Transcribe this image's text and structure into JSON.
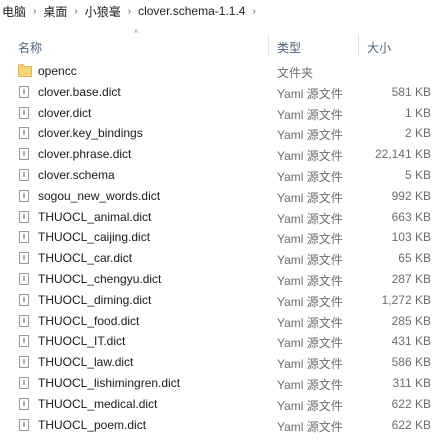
{
  "breadcrumb": {
    "items": [
      "电脑",
      "桌面",
      "小狼毫",
      "clover.schema-1.1.4"
    ],
    "separator": "›"
  },
  "columns": {
    "name": "名称",
    "type": "类型",
    "size": "大小",
    "sort_indicator": "^"
  },
  "files": [
    {
      "name": "opencc",
      "type": "文件夹",
      "size": "",
      "icon": "folder-icon"
    },
    {
      "name": "clover.base.dict",
      "type": "Yaml 源文件",
      "size": "581 KB",
      "icon": "file-icon"
    },
    {
      "name": "clover.dict",
      "type": "Yaml 源文件",
      "size": "1 KB",
      "icon": "file-icon"
    },
    {
      "name": "clover.key_bindings",
      "type": "Yaml 源文件",
      "size": "2 KB",
      "icon": "file-icon"
    },
    {
      "name": "clover.phrase.dict",
      "type": "Yaml 源文件",
      "size": "22,141 KB",
      "icon": "file-icon"
    },
    {
      "name": "clover.schema",
      "type": "Yaml 源文件",
      "size": "5 KB",
      "icon": "file-icon"
    },
    {
      "name": "sogou_new_words.dict",
      "type": "Yaml 源文件",
      "size": "992 KB",
      "icon": "file-icon"
    },
    {
      "name": "THUOCL_animal.dict",
      "type": "Yaml 源文件",
      "size": "663 KB",
      "icon": "file-icon"
    },
    {
      "name": "THUOCL_caijing.dict",
      "type": "Yaml 源文件",
      "size": "103 KB",
      "icon": "file-icon"
    },
    {
      "name": "THUOCL_car.dict",
      "type": "Yaml 源文件",
      "size": "65 KB",
      "icon": "file-icon"
    },
    {
      "name": "THUOCL_chengyu.dict",
      "type": "Yaml 源文件",
      "size": "287 KB",
      "icon": "file-icon"
    },
    {
      "name": "THUOCL_diming.dict",
      "type": "Yaml 源文件",
      "size": "1,272 KB",
      "icon": "file-icon"
    },
    {
      "name": "THUOCL_food.dict",
      "type": "Yaml 源文件",
      "size": "285 KB",
      "icon": "file-icon"
    },
    {
      "name": "THUOCL_IT.dict",
      "type": "Yaml 源文件",
      "size": "431 KB",
      "icon": "file-icon"
    },
    {
      "name": "THUOCL_law.dict",
      "type": "Yaml 源文件",
      "size": "586 KB",
      "icon": "file-icon"
    },
    {
      "name": "THUOCL_lishimingren.dict",
      "type": "Yaml 源文件",
      "size": "311 KB",
      "icon": "file-icon"
    },
    {
      "name": "THUOCL_medical.dict",
      "type": "Yaml 源文件",
      "size": "622 KB",
      "icon": "file-icon"
    },
    {
      "name": "THUOCL_poem.dict",
      "type": "Yaml 源文件",
      "size": "622 KB",
      "icon": "file-icon"
    }
  ]
}
